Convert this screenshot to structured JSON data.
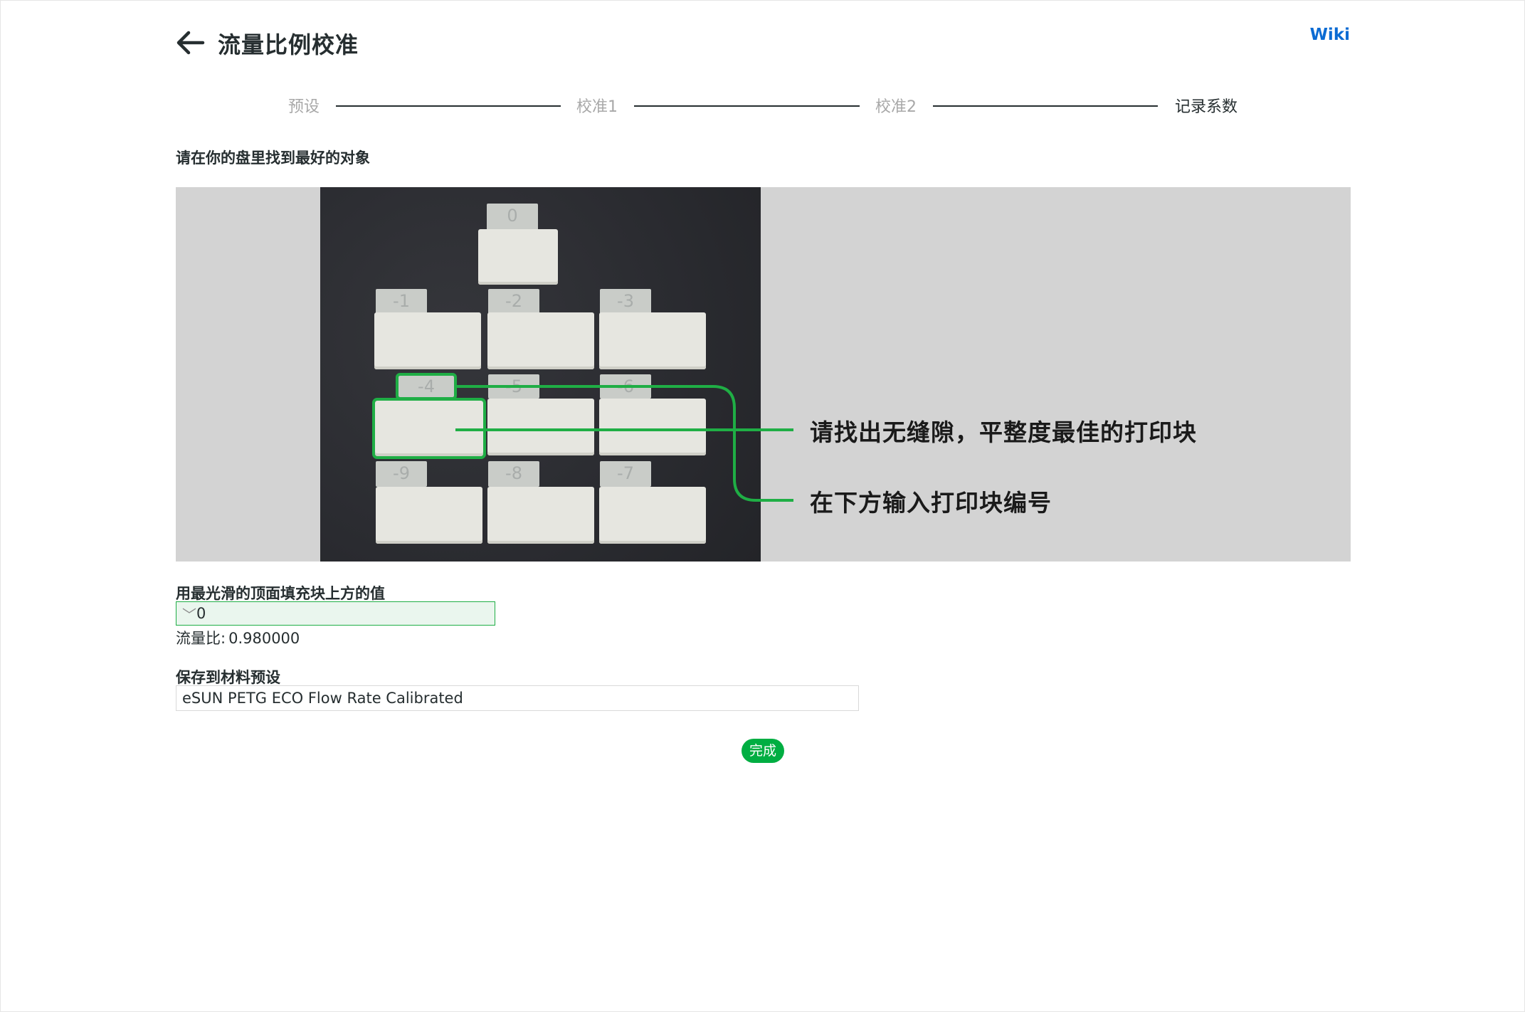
{
  "header": {
    "back_icon": "arrow-left-icon",
    "title": "流量比例校准",
    "wiki_label": "Wiki"
  },
  "steps": [
    {
      "label": "预设",
      "state": "done"
    },
    {
      "label": "校准1",
      "state": "done"
    },
    {
      "label": "校准2",
      "state": "done"
    },
    {
      "label": "记录系数",
      "state": "active"
    }
  ],
  "instruction": "请在你的盘里找到最好的对象",
  "figure": {
    "annotation_1": "请找出无缝隙，平整度最佳的打印块",
    "annotation_2": "在下方输入打印块编号",
    "tab_labels": [
      "0",
      "-1",
      "-2",
      "-3",
      "-4",
      "-5",
      "-6",
      "-9",
      "-8",
      "-7"
    ],
    "highlight_color": "#1fae45"
  },
  "form": {
    "smooth_label": "用最光滑的顶面填充块上方的值",
    "smooth_value": "0",
    "ratio_label": "流量比:",
    "ratio_value": "0.980000",
    "preset_label": "保存到材料预设",
    "preset_value": "eSUN PETG ECO Flow Rate Calibrated"
  },
  "actions": {
    "done_label": "完成",
    "accent_color": "#00ae42"
  }
}
